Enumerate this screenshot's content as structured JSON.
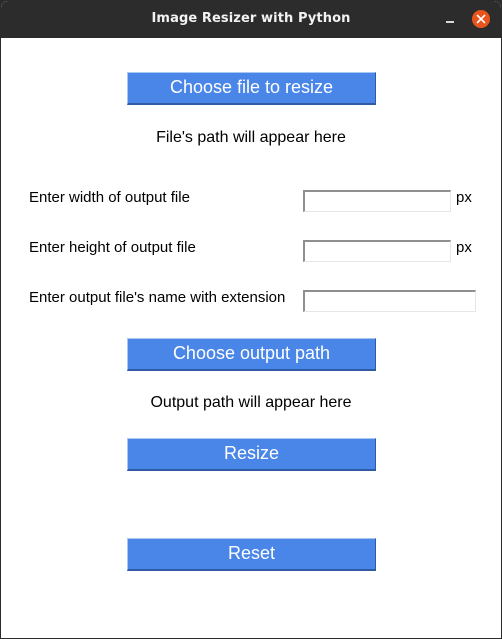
{
  "window": {
    "title": "Image Resizer with Python"
  },
  "buttons": {
    "choose_file": "Choose file to resize",
    "choose_output": "Choose output path",
    "resize": "Resize",
    "reset": "Reset"
  },
  "status": {
    "file_path": "File's path will appear here",
    "output_path": "Output path will appear here"
  },
  "fields": {
    "width_label": "Enter width of output file",
    "width_value": "",
    "width_unit": "px",
    "height_label": "Enter height of output file",
    "height_value": "",
    "height_unit": "px",
    "name_label": "Enter output file's name with extension",
    "name_value": ""
  },
  "colors": {
    "button_bg": "#4a86e8",
    "titlebar_bg": "#2c2c2c",
    "close_button": "#e9541d"
  },
  "icons": {
    "minimize": "minimize-icon",
    "close": "close-icon"
  }
}
